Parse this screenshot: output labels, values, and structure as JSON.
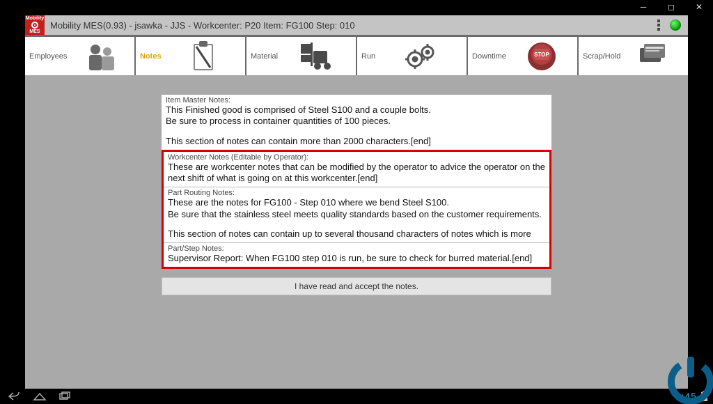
{
  "window": {
    "title": "Mobility MES(0.93) - jsawka - JJS - Workcenter: P20 Item: FG100 Step: 010"
  },
  "logo": {
    "top": "Mobility",
    "bottom": "MES"
  },
  "tabs": {
    "employees": "Employees",
    "notes": "Notes",
    "material": "Material",
    "run": "Run",
    "downtime": "Downtime",
    "scraphold": "Scrap/Hold"
  },
  "notes": {
    "item_master": {
      "header": "Item Master Notes:",
      "line1": "This Finished good is comprised of Steel S100 and a couple bolts.",
      "line2": "Be sure to process in container quantities of 100 pieces.",
      "line3": "This section of notes can contain more than 2000 characters.[end]"
    },
    "workcenter": {
      "header": "Workcenter Notes (Editable by Operator):",
      "line1": "These are workcenter notes that can be modified by the operator to advice  the operator on the next shift of what is going on at this workcenter.[end]"
    },
    "part_routing": {
      "header": "Part Routing Notes:",
      "line1": "These are the notes for FG100 - Step 010 where we bend Steel S100.",
      "line2": "Be sure that the stainless steel meets quality standards based on the customer requirements.",
      "line3": "This section of notes can contain up to several thousand characters of notes which is more"
    },
    "part_step": {
      "header": "Part/Step Notes:",
      "line1": "Supervisor Report: When FG100 step 010 is run, be sure to check for burred material.[end]"
    }
  },
  "accept_button": "I have read and accept the notes.",
  "clock": "8:45"
}
